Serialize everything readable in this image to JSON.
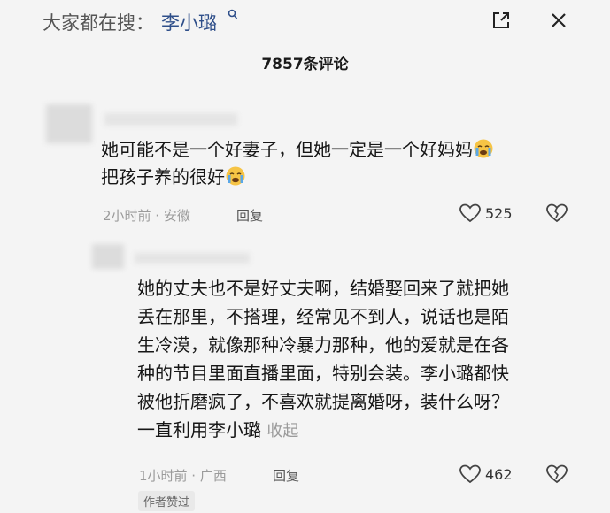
{
  "search": {
    "prefix": "大家都在搜：",
    "query": "李小璐"
  },
  "header": {
    "comment_count": "7857条评论"
  },
  "comments": [
    {
      "text_line1": "她可能不是一个好妻子，但她一定是一个好妈妈",
      "text_line2": "把孩子养的很好",
      "emoji": "crying-face",
      "meta": "2小时前 · 安徽",
      "reply_label": "回复",
      "likes": "525"
    },
    {
      "text_lines": [
        "她的丈夫也不是好丈夫啊，结婚娶回来了就把她",
        "丢在那里，不搭理，经常见不到人，说话也是陌",
        "生冷漠，就像那种冷暴力那种，他的爱就是在各",
        "种的节目里面直播里面，特别会装。李小璐都快",
        "被他折磨疯了，不喜欢就提离婚呀，装什么呀？",
        "一直利用李小璐"
      ],
      "collapse_label": "收起",
      "meta": "1小时前 · 广西",
      "reply_label": "回复",
      "likes": "462",
      "badge": "作者赞过"
    }
  ],
  "colors": {
    "background": "#f4f4f4",
    "search_query": "#2f4f8a",
    "meta_gray": "#9b9b9b"
  }
}
